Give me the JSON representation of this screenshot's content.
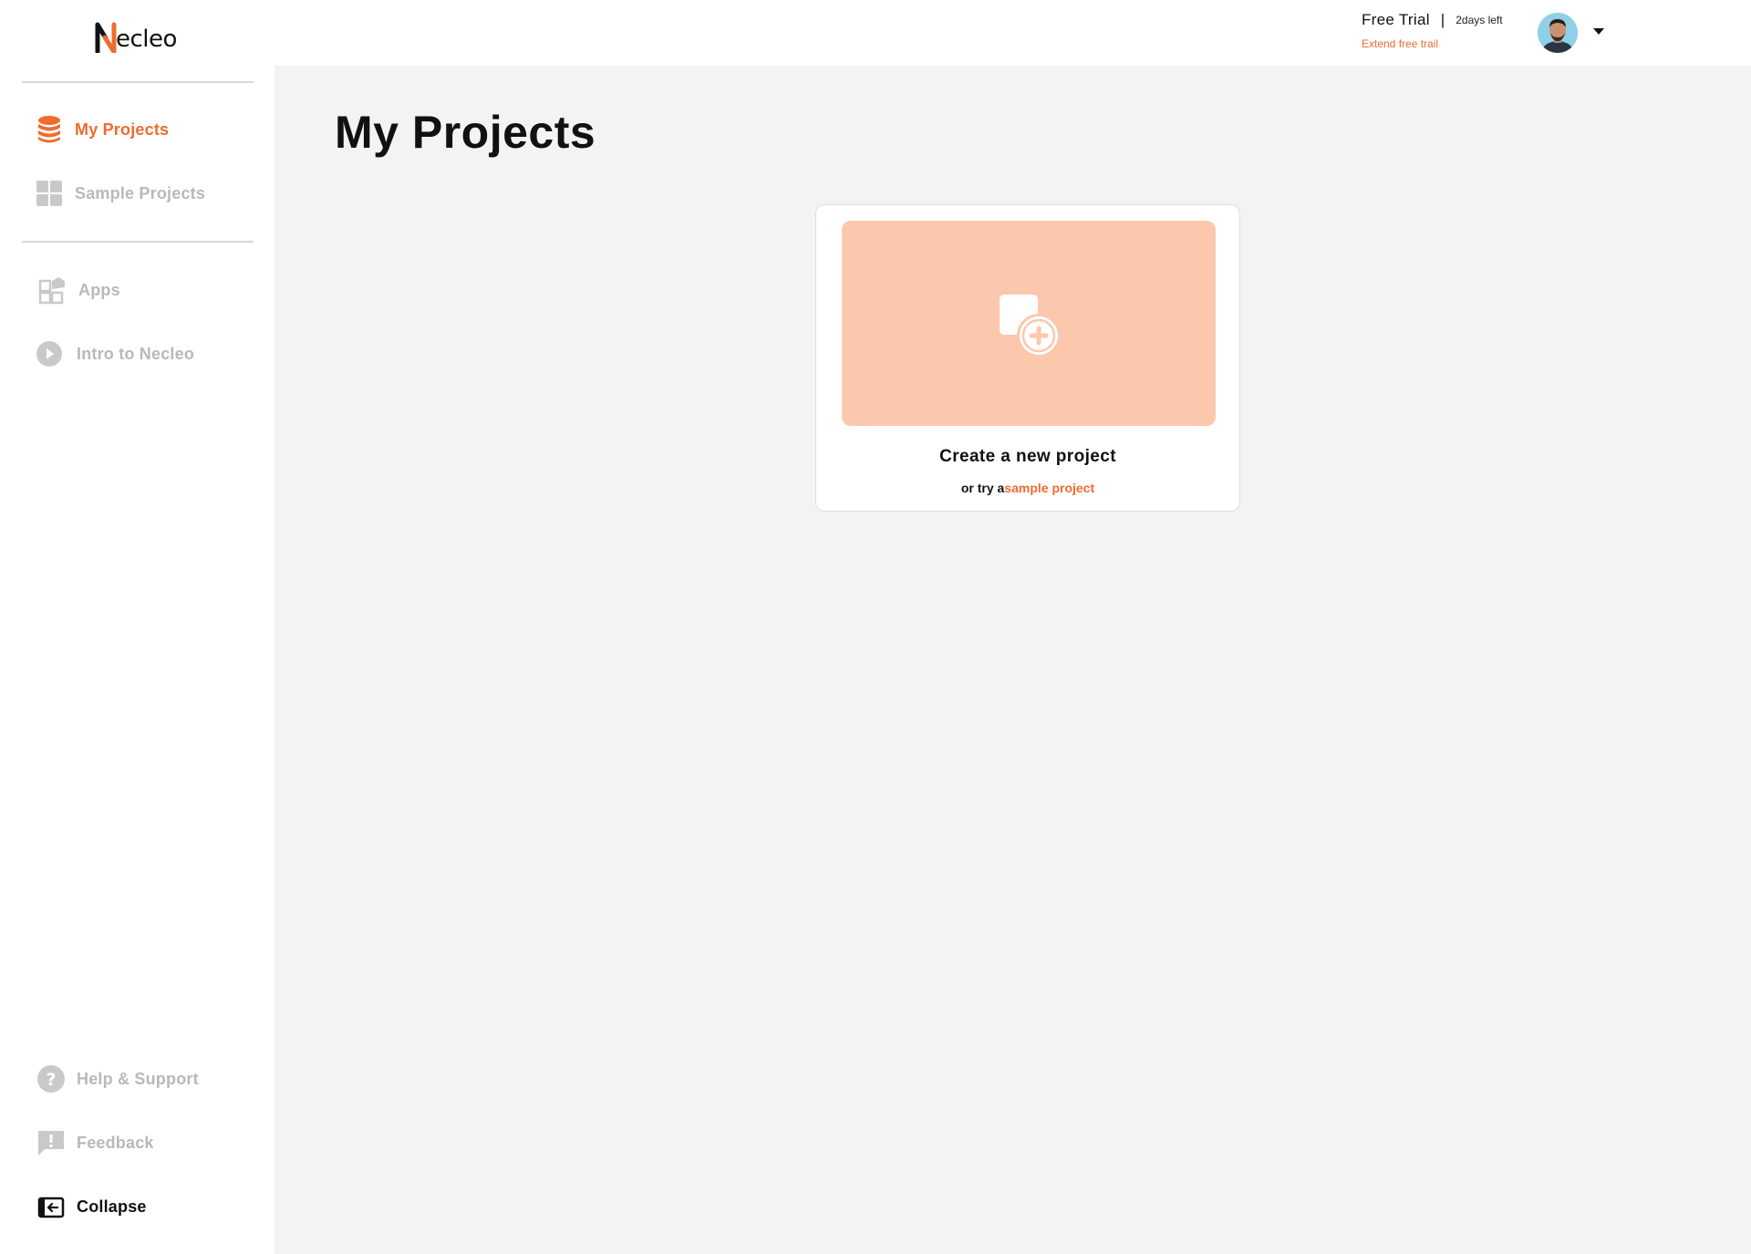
{
  "app": {
    "name": "Necleo",
    "logo_letter": "N",
    "logo_rest": "ecleo"
  },
  "colors": {
    "accent": "#ef6b2f",
    "muted": "#b9b9b9",
    "card_art": "#fbc8ad",
    "background": "#f3f3f3"
  },
  "header": {
    "trial_title": "Free Trial",
    "separator": "|",
    "days_left": "2days left",
    "extend_link": "Extend free trail"
  },
  "sidebar": {
    "items": [
      {
        "label": "My Projects",
        "icon": "database-icon",
        "active": true
      },
      {
        "label": "Sample Projects",
        "icon": "grid-icon",
        "active": false
      },
      {
        "label": "Apps",
        "icon": "apps-icon",
        "active": false
      },
      {
        "label": "Intro to Necleo",
        "icon": "play-icon",
        "active": false
      }
    ],
    "bottom_items": [
      {
        "label": "Help & Support",
        "icon": "help-icon"
      },
      {
        "label": "Feedback",
        "icon": "feedback-icon"
      },
      {
        "label": "Collapse",
        "icon": "collapse-icon"
      }
    ]
  },
  "main": {
    "title": "My Projects",
    "card": {
      "title": "Create a new project",
      "subtitle_prefix": "or try a",
      "subtitle_link": "sample project",
      "icon": "add-file-icon"
    }
  }
}
